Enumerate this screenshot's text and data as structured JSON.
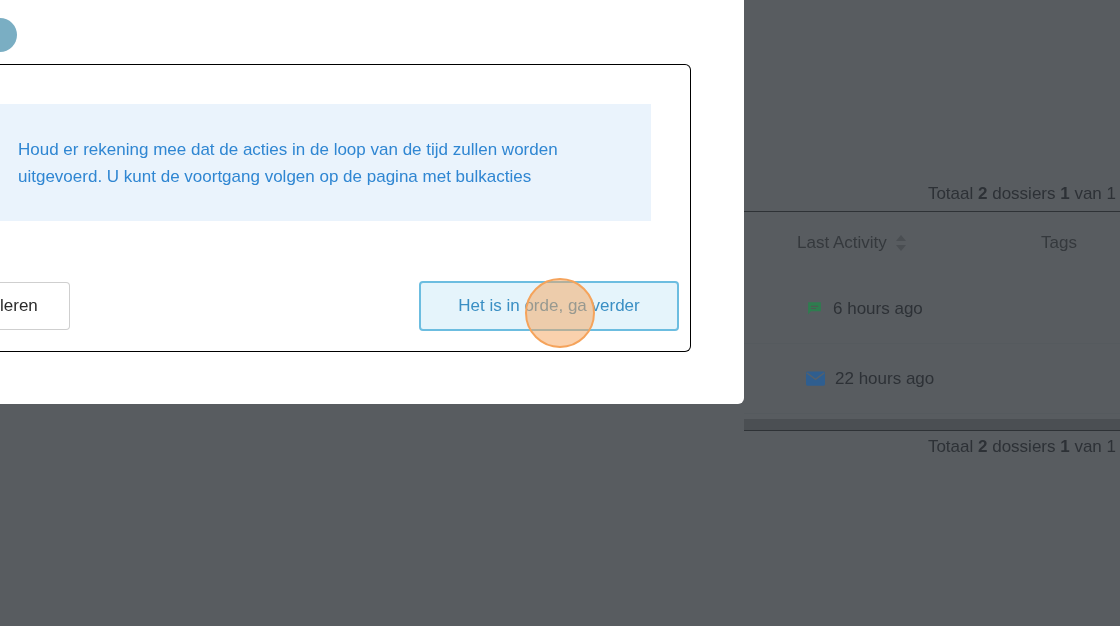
{
  "dialog": {
    "message": "Houd er rekening mee dat de acties in de loop van de tijd zullen worden uitgevoerd. U kunt de voortgang volgen op de pagina met bulkacties",
    "buttons": [
      {
        "label": "leren",
        "kind": "secondary"
      },
      {
        "label": "Het is in orde, ga verder",
        "kind": "primary"
      }
    ]
  },
  "background": {
    "top_total": "Totaal **2** dossiers **1** van 1",
    "table": {
      "columns": [
        {
          "label": "Last Activity",
          "sortable": true
        },
        {
          "label": "Tags",
          "sortable": false
        }
      ],
      "rows": [
        {
          "activity": "6 hours ago",
          "kind": "message"
        },
        {
          "activity": "22 hours ago",
          "kind": "email"
        }
      ]
    },
    "bottom_total": "Totaal **2** dossiers **1** van 1"
  }
}
